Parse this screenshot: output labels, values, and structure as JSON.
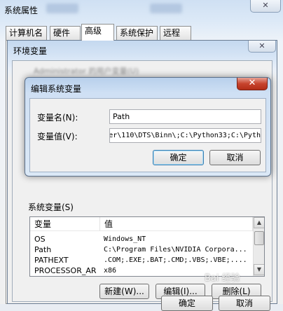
{
  "system_properties": {
    "title": "系统属性",
    "blurred_taskbar_1": "下载",
    "blurred_taskbar_2": "NotW",
    "close_icon": "close-icon",
    "tabs": [
      {
        "label": "计算机名"
      },
      {
        "label": "硬件"
      },
      {
        "label": "高级"
      },
      {
        "label": "系统保护"
      },
      {
        "label": "远程"
      }
    ],
    "active_tab": "高级",
    "bottom_buttons": {
      "ok": "确定",
      "cancel": "取消"
    }
  },
  "env_vars": {
    "title": "环境变量",
    "blurred_header": "Administrator 的用户变量(U)",
    "system_vars_label": "系统变量(S)",
    "columns": {
      "name": "变量",
      "value": "值"
    },
    "rows": [
      {
        "name": "OS",
        "value": "Windows_NT"
      },
      {
        "name": "Path",
        "value": "C:\\Program Files\\NVIDIA Corpora..."
      },
      {
        "name": "PATHEXT",
        "value": ".COM;.EXE;.BAT;.CMD;.VBS;.VBE;...."
      },
      {
        "name": "PROCESSOR_AR",
        "value": "x86"
      }
    ],
    "buttons": {
      "new": "新建(W)...",
      "edit": "编辑(I)...",
      "delete": "删除(L)"
    }
  },
  "edit_dialog": {
    "title": "编辑系统变量",
    "name_label": "变量名(N):",
    "name_value": "Path",
    "value_label": "变量值(V):",
    "value_value": "er\\110\\DTS\\Binn\\;C:\\Python33;C:\\Pyth",
    "ok": "确定",
    "cancel": "取消",
    "close_icon": "close-icon",
    "close_color": "#c7432d"
  },
  "watermark": "Bai 经验"
}
